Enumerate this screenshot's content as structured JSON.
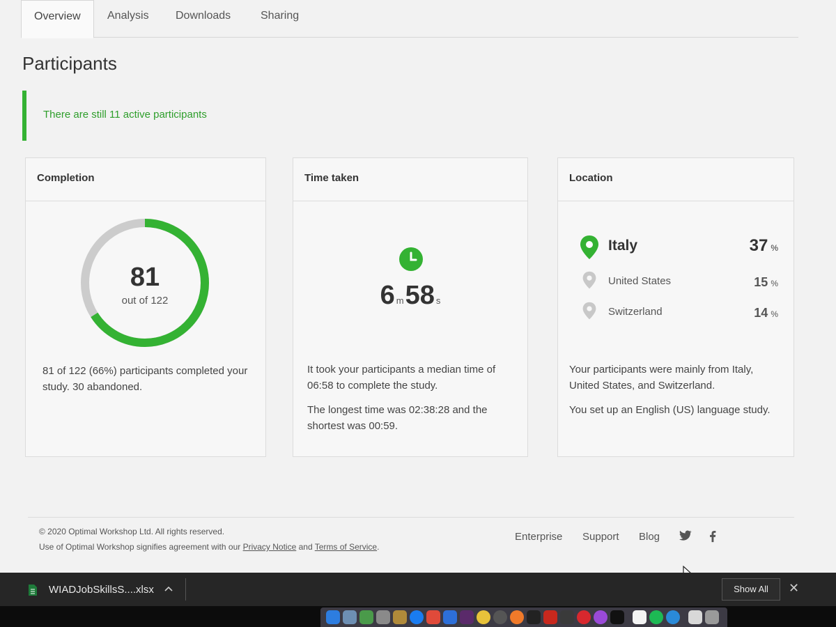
{
  "tabs": [
    {
      "label": "Overview"
    },
    {
      "label": "Analysis"
    },
    {
      "label": "Downloads"
    },
    {
      "label": "Sharing"
    }
  ],
  "page_title": "Participants",
  "alert": "There are still 11 active participants",
  "completion": {
    "title": "Completion",
    "completed": "81",
    "out_of": "out of 122",
    "progress_fraction": 0.66,
    "description": "81 of 122 (66%) participants completed your study. 30 abandoned."
  },
  "time_taken": {
    "title": "Time taken",
    "minutes": "6",
    "minutes_unit": "m",
    "seconds": "58",
    "seconds_unit": "s",
    "description1": "It took your participants a median time of 06:58 to complete the study.",
    "description2": "The longest time was 02:38:28 and the shortest was 00:59."
  },
  "location": {
    "title": "Location",
    "items": [
      {
        "name": "Italy",
        "percent": "37",
        "unit": "%"
      },
      {
        "name": "United States",
        "percent": "15",
        "unit": "%"
      },
      {
        "name": "Switzerland",
        "percent": "14",
        "unit": "%"
      }
    ],
    "description1": "Your participants were mainly from Italy, United States, and Switzerland.",
    "description2": "You set up an English (US) language study."
  },
  "footer": {
    "copyright": "© 2020 Optimal Workshop Ltd. All rights reserved.",
    "terms_prefix": "Use of Optimal Workshop signifies agreement with our ",
    "privacy_link": "Privacy Notice",
    "and": " and ",
    "terms_link": "Terms of Service",
    "terms_suffix": ".",
    "links": [
      "Enterprise",
      "Support",
      "Blog"
    ]
  },
  "download_bar": {
    "file_name": "WIADJobSkillsS....xlsx",
    "show_all": "Show All"
  },
  "colors": {
    "accent_green": "#34b233",
    "track_grey": "#cccccc",
    "dl_bar_bg": "#262626"
  }
}
